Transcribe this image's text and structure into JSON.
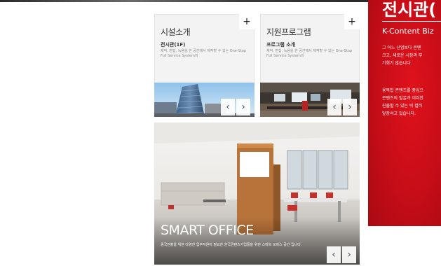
{
  "cards": {
    "facility": {
      "title": "시설소개",
      "subtitle": "전시관(1F)",
      "description": "제작, 편집, 녹음을 한 공간에서 제작할 수 있는 One-Stop Full Service System의",
      "plus": "+"
    },
    "program": {
      "title": "지원프로그램",
      "subtitle": "프로그램 소개",
      "description": "제작, 편집, 녹음을 한 공간에서 제작할 수 있는 One-Stop Full Service System의",
      "plus": "+"
    },
    "office": {
      "title": "SMART OFFICE",
      "description": "중국진출을 위한 다양한 업무지원이 필요한 한국콘텐츠기업들을 위한 스마트 오피스 공간 입니다."
    }
  },
  "nav": {
    "prev": "‹",
    "next": "›"
  },
  "side_panel": {
    "heading": "전시관(",
    "subheading": "K-Content Biz",
    "paragraph1": "그 어느 산업보다 콘텐\n크고, 새로운 시장과 부\n기회가 많습니다.",
    "paragraph2": "융복합 콘텐츠를 중심으\n콘텐츠의 발굴과 이러한\n진출할 수 있는 빅 컬러\n앞장서고 있습니다."
  },
  "colors": {
    "brand_red": "#c60d18",
    "card_bg": "#f3f3f3",
    "text_dark": "#333333"
  }
}
